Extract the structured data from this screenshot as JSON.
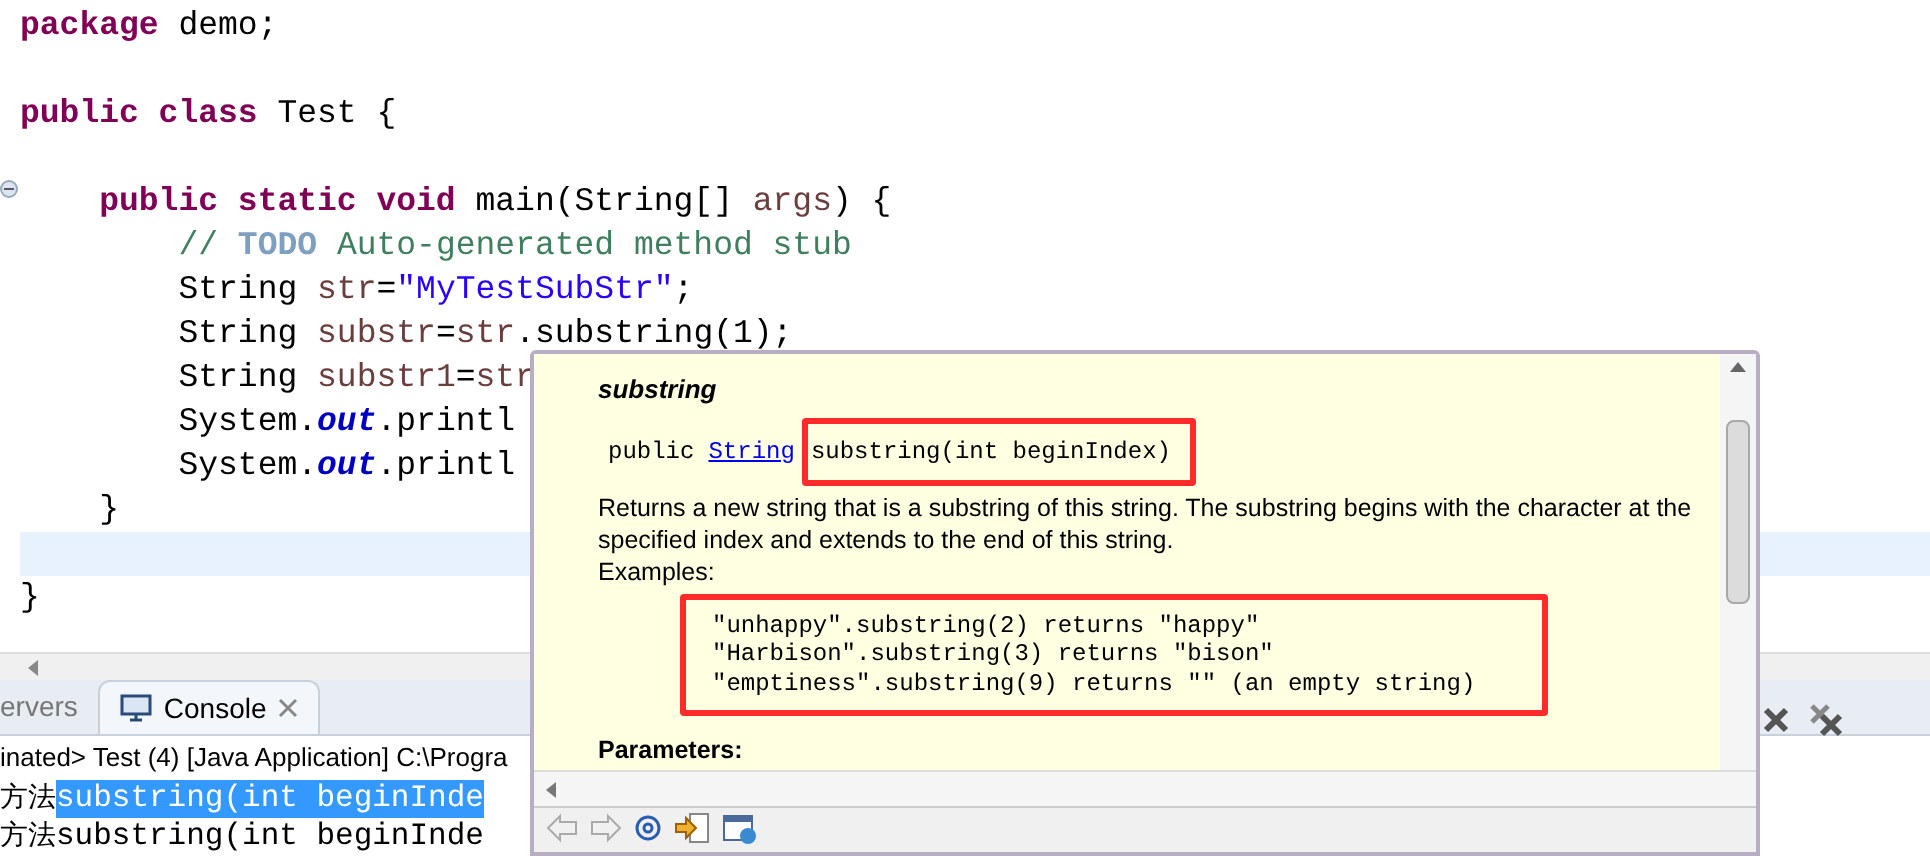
{
  "editor": {
    "lines": [
      {
        "current": false,
        "tokens": [
          {
            "kind": "keyword",
            "text": "package"
          },
          {
            "kind": "plain",
            "text": " demo;"
          }
        ]
      },
      {
        "current": false
      },
      {
        "current": false,
        "tokens": [
          {
            "kind": "keyword",
            "text": "public class"
          },
          {
            "kind": "plain",
            "text": " Test {"
          }
        ]
      },
      {
        "current": false
      },
      {
        "current": false,
        "expanded": true,
        "tokens": [
          {
            "kind": "keyword",
            "text": "    public static void"
          },
          {
            "kind": "plain",
            "text": " main(String[] "
          },
          {
            "kind": "local",
            "text": "args"
          },
          {
            "kind": "plain",
            "text": ") {"
          }
        ]
      },
      {
        "current": false,
        "tokens": [
          {
            "kind": "comment",
            "text": "        //"
          },
          {
            "kind": "todo",
            "text": " TODO"
          },
          {
            "kind": "comment",
            "text": " Auto-generated method stub"
          }
        ]
      },
      {
        "current": false,
        "tokens": [
          {
            "kind": "plain",
            "text": "        String "
          },
          {
            "kind": "local",
            "text": "str"
          },
          {
            "kind": "plain",
            "text": "="
          },
          {
            "kind": "string",
            "text": "\"MyTestSubStr\""
          },
          {
            "kind": "plain",
            "text": ";"
          }
        ]
      },
      {
        "current": false,
        "tokens": [
          {
            "kind": "plain",
            "text": "        String "
          },
          {
            "kind": "local",
            "text": "substr"
          },
          {
            "kind": "plain",
            "text": "="
          },
          {
            "kind": "local",
            "text": "str"
          },
          {
            "kind": "plain",
            "text": ".substring(1);"
          }
        ]
      },
      {
        "current": false,
        "tokens": [
          {
            "kind": "plain",
            "text": "        String "
          },
          {
            "kind": "local",
            "text": "substr1"
          },
          {
            "kind": "plain",
            "text": "="
          },
          {
            "kind": "local",
            "text": "str"
          }
        ]
      },
      {
        "current": false,
        "tokens": [
          {
            "kind": "plain",
            "text": "        System."
          },
          {
            "kind": "field",
            "text": "out"
          },
          {
            "kind": "plain",
            "text": ".printl"
          }
        ]
      },
      {
        "current": false,
        "tokens": [
          {
            "kind": "plain",
            "text": "        System."
          },
          {
            "kind": "field",
            "text": "out"
          },
          {
            "kind": "plain",
            "text": ".printl"
          }
        ]
      },
      {
        "current": false,
        "tokens": [
          {
            "kind": "plain",
            "text": "    }"
          }
        ]
      },
      {
        "current": true
      },
      {
        "current": false,
        "tokens": [
          {
            "kind": "plain",
            "text": "}"
          }
        ]
      }
    ]
  },
  "console": {
    "tabs": [
      {
        "label": "ervers",
        "selected": false
      },
      {
        "label": "Console",
        "selected": true
      }
    ],
    "header": "inated> Test (4) [Java Application] C:\\Progra",
    "output": [
      {
        "prefix": "方法",
        "text": "substring(int beginInde",
        "selected": true
      },
      {
        "prefix": "方法",
        "text": "substring(int beginInde",
        "selected": false
      }
    ]
  },
  "javadoc_popup": {
    "title": "substring",
    "signature": {
      "modifier": "public",
      "return_type": "String",
      "method": "substring(int beginIndex)"
    },
    "description": "Returns a new string that is a substring of this string. The substring begins with the character at the specified index and extends to the end of this string.",
    "examples_label": "Examples:",
    "examples": [
      "\"unhappy\".substring(2) returns \"happy\"",
      "\"Harbison\".substring(3) returns \"bison\"",
      "\"emptiness\".substring(9) returns \"\" (an empty string)"
    ],
    "parameters_label": "Parameters:"
  }
}
